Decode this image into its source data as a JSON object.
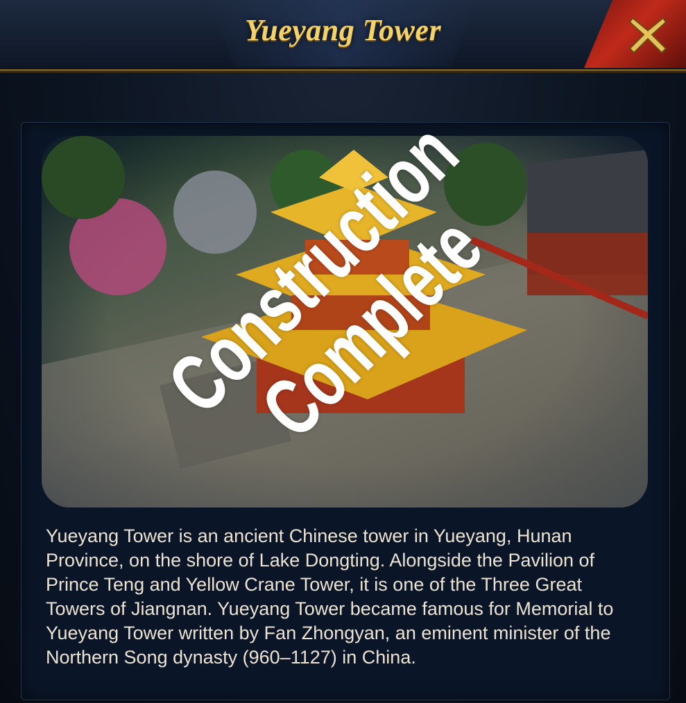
{
  "dialog": {
    "title": "Yueyang Tower",
    "close_icon": "close-icon",
    "accent_gold": "#f2d36b",
    "close_red": "#c02a1a"
  },
  "image": {
    "subject": "building-illustration"
  },
  "description": "Yueyang Tower is an ancient Chinese tower in Yueyang, Hunan Province, on the shore of Lake Dongting. Alongside the Pavilion of Prince Teng and Yellow Crane Tower, it is one of the Three Great Towers of Jiangnan. Yueyang Tower became famous for Memorial to Yueyang Tower written by Fan Zhongyan, an eminent minister of the Northern Song dynasty (960–1127) in China.",
  "overlay": {
    "line1": "Construction",
    "line2": "Complete"
  }
}
